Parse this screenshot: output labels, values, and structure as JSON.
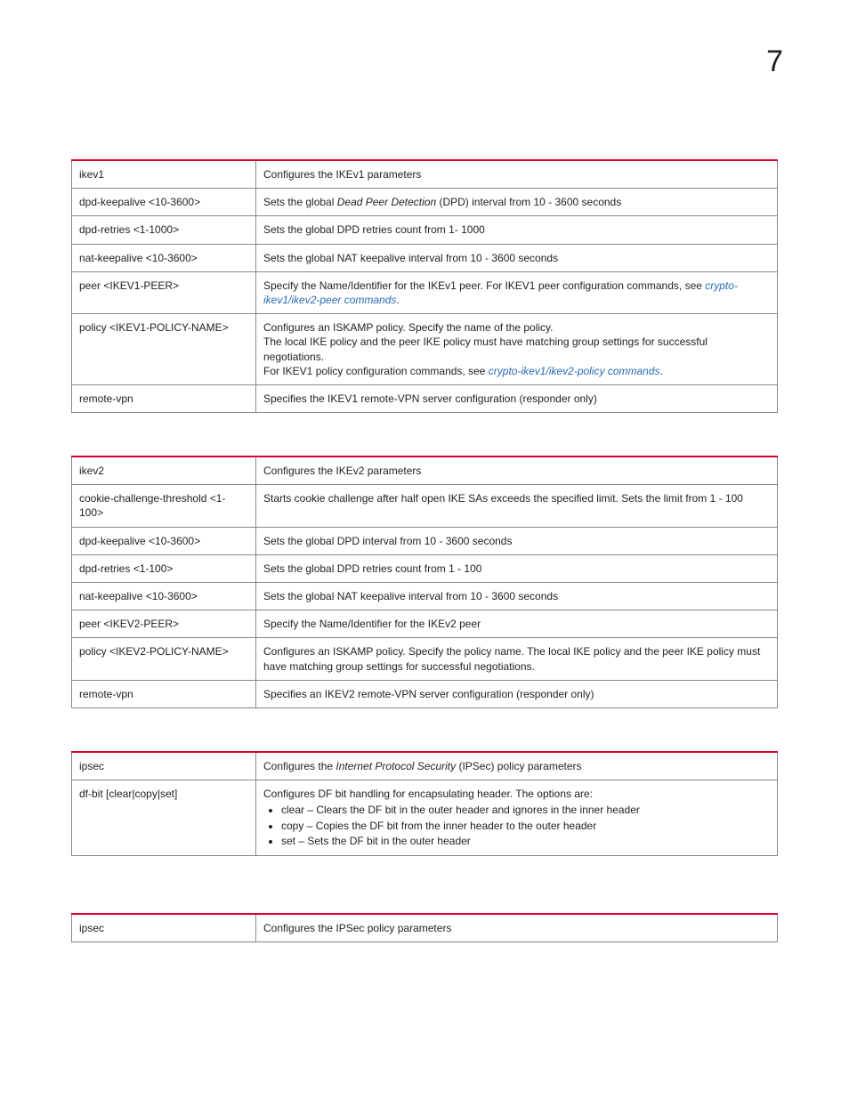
{
  "page_number": "7",
  "table1": {
    "rows": [
      {
        "param": "ikev1",
        "desc_plain": "Configures the IKEv1 parameters"
      },
      {
        "param": "dpd-keepalive <10-3600>",
        "desc_html": "Sets the global <span class=\"ital\">Dead Peer Detection</span> (DPD) interval from 10 - 3600 seconds"
      },
      {
        "param": "dpd-retries <1-1000>",
        "desc_plain": "Sets the global DPD retries count from 1- 1000"
      },
      {
        "param": "nat-keepalive <10-3600>",
        "desc_plain": "Sets the global NAT keepalive interval from 10 - 3600 seconds"
      },
      {
        "param": "peer <IKEV1-PEER>",
        "desc_html": "Specify the Name/Identifier for the IKEv1 peer. For IKEV1 peer configuration commands, see <span class=\"link\">crypto-ikev1/ikev2-peer commands</span>."
      },
      {
        "param": "policy <IKEV1-POLICY-NAME>",
        "desc_html": "Configures an ISKAMP policy. Specify the name of the policy.<br>The local IKE policy and the peer IKE policy must have matching group settings for successful negotiations.<br>For IKEV1 policy configuration commands, see <span class=\"link\">crypto-ikev1/ikev2-policy commands</span>."
      },
      {
        "param": "remote-vpn",
        "desc_plain": "Specifies the IKEV1 remote-VPN server configuration (responder only)"
      }
    ]
  },
  "table2": {
    "rows": [
      {
        "param": "ikev2",
        "desc_plain": "Configures the IKEv2 parameters"
      },
      {
        "param": "cookie-challenge-threshold <1-100>",
        "desc_plain": "Starts cookie challenge after half open IKE SAs exceeds the specified limit. Sets the limit from 1 - 100"
      },
      {
        "param": "dpd-keepalive <10-3600>",
        "desc_plain": "Sets the global DPD interval from 10 - 3600 seconds"
      },
      {
        "param": "dpd-retries <1-100>",
        "desc_plain": "Sets the global DPD retries count from 1 - 100"
      },
      {
        "param": "nat-keepalive <10-3600>",
        "desc_plain": "Sets the global NAT keepalive interval from 10 - 3600 seconds"
      },
      {
        "param": "peer <IKEV2-PEER>",
        "desc_plain": "Specify the Name/Identifier for the IKEv2 peer"
      },
      {
        "param": "policy <IKEV2-POLICY-NAME>",
        "desc_plain": "Configures an ISKAMP policy. Specify the policy name.\nThe local IKE policy and the peer IKE policy must have matching group settings for successful negotiations."
      },
      {
        "param": "remote-vpn",
        "desc_plain": "Specifies an IKEV2 remote-VPN server configuration (responder only)"
      }
    ]
  },
  "table3": {
    "rows": [
      {
        "param": "ipsec",
        "desc_html": "Configures the <span class=\"ital\">Internet Protocol Security</span> (IPSec) policy parameters"
      },
      {
        "param": "df-bit [clear|copy|set]",
        "desc_html": "Configures DF bit handling for encapsulating header. The options are:<ul class=\"bullets\"><li>clear – Clears the DF bit in the outer header and ignores in the inner header</li><li>copy – Copies the DF bit from the inner header to the outer header</li><li>set – Sets the DF bit in the outer header</li></ul>"
      }
    ]
  },
  "table4": {
    "rows": [
      {
        "param": "ipsec",
        "desc_plain": "Configures the IPSec policy parameters"
      }
    ]
  }
}
